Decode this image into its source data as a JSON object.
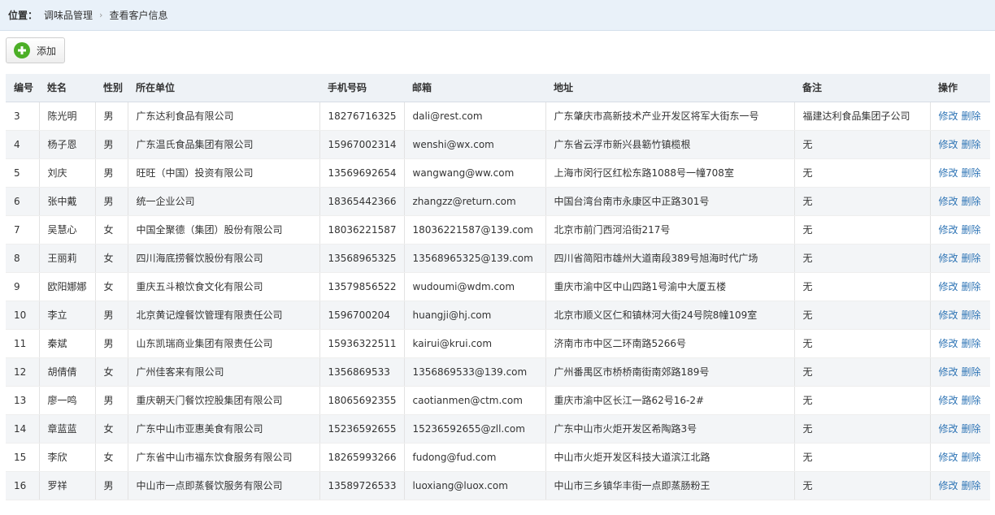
{
  "breadcrumb": {
    "label": "位置：",
    "items": [
      "调味品管理",
      "查看客户信息"
    ],
    "separator": "›"
  },
  "toolbar": {
    "add_label": "添加"
  },
  "table": {
    "headers": [
      "编号",
      "姓名",
      "性别",
      "所在单位",
      "手机号码",
      "邮箱",
      "地址",
      "备注",
      "操作"
    ],
    "edit_label": "修改",
    "delete_label": "删除",
    "rows": [
      [
        "3",
        "陈光明",
        "男",
        "广东达利食品有限公司",
        "18276716325",
        "dali@rest.com",
        "广东肇庆市高新技术产业开发区将军大街东一号",
        "福建达利食品集团子公司"
      ],
      [
        "4",
        "杨子恩",
        "男",
        "广东温氏食品集团有限公司",
        "15967002314",
        "wenshi@wx.com",
        "广东省云浮市新兴县簕竹镇榄根",
        "无"
      ],
      [
        "5",
        "刘庆",
        "男",
        "旺旺（中国）投资有限公司",
        "13569692654",
        "wangwang@ww.com",
        "上海市闵行区红松东路1088号一幢708室",
        "无"
      ],
      [
        "6",
        "张中戴",
        "男",
        "统一企业公司",
        "18365442366",
        "zhangzz@return.com",
        "中国台湾台南市永康区中正路301号",
        "无"
      ],
      [
        "7",
        "吴慧心",
        "女",
        "中国全聚德（集团）股份有限公司",
        "18036221587",
        "18036221587@139.com",
        "北京市前门西河沿街217号",
        "无"
      ],
      [
        "8",
        "王丽莉",
        "女",
        "四川海底捞餐饮股份有限公司",
        "13568965325",
        "13568965325@139.com",
        "四川省简阳市雄州大道南段389号旭海时代广场",
        "无"
      ],
      [
        "9",
        "欧阳娜娜",
        "女",
        "重庆五斗粮饮食文化有限公司",
        "13579856522",
        "wudoumi@wdm.com",
        "重庆市渝中区中山四路1号渝中大厦五楼",
        "无"
      ],
      [
        "10",
        "李立",
        "男",
        "北京黄记煌餐饮管理有限责任公司",
        "1596700204",
        "huangji@hj.com",
        "北京市顺义区仁和镇林河大街24号院8幢109室",
        "无"
      ],
      [
        "11",
        "秦斌",
        "男",
        "山东凯瑞商业集团有限责任公司",
        "15936322511",
        "kairui@krui.com",
        "济南市市中区二环南路5266号",
        "无"
      ],
      [
        "12",
        "胡倩倩",
        "女",
        "广州佳客来有限公司",
        "1356869533",
        "1356869533@139.com",
        "广州番禺区市桥桥南街南郊路189号",
        "无"
      ],
      [
        "13",
        "廖一鸣",
        "男",
        "重庆朝天门餐饮控股集团有限公司",
        "18065692355",
        "caotianmen@ctm.com",
        "重庆市渝中区长江一路62号16-2#",
        "无"
      ],
      [
        "14",
        "章蓝蓝",
        "女",
        "广东中山市亚惠美食有限公司",
        "15236592655",
        "15236592655@zll.com",
        "广东中山市火炬开发区希陶路3号",
        "无"
      ],
      [
        "15",
        "李欣",
        "女",
        "广东省中山市福东饮食服务有限公司",
        "18265993266",
        "fudong@fud.com",
        "中山市火炬开发区科技大道滨江北路",
        "无"
      ],
      [
        "16",
        "罗祥",
        "男",
        "中山市一点即蒸餐饮服务有限公司",
        "13589726533",
        "luoxiang@luox.com",
        "中山市三乡镇华丰街一点即蒸肠粉王",
        "无"
      ]
    ]
  }
}
